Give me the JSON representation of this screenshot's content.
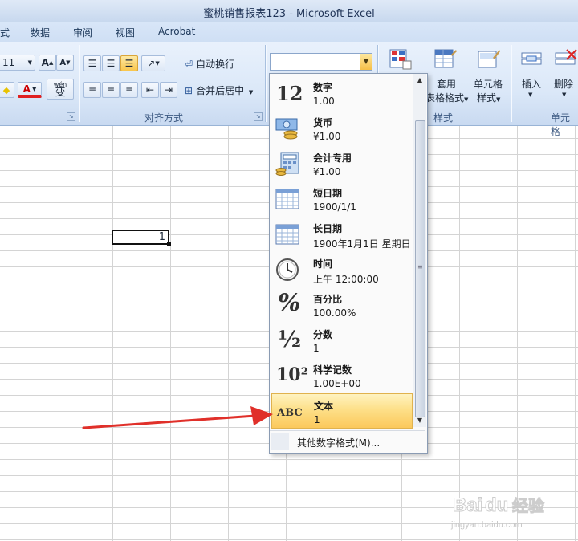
{
  "window": {
    "title": "蜜桃销售报表123 - Microsoft Excel"
  },
  "tabs": [
    "式",
    "数据",
    "审阅",
    "视图",
    "Acrobat"
  ],
  "ribbon": {
    "font_size": "11",
    "font_grow": "A",
    "font_shrink": "A",
    "font_color_letter": "A",
    "wrap_text": "自动换行",
    "merge_center": "合并后居中",
    "alignment_group": "对齐方式",
    "styles_group": "样式",
    "table_format": "表格格式",
    "cell_styles": "单元格\n样式",
    "cell_styles_line1": "单元格",
    "cell_styles_line2": "样式",
    "table_format_line1": "套用",
    "insert": "插入",
    "delete": "删除",
    "cells_group": "单元格",
    "phonetic": "wén"
  },
  "sheet": {
    "active_cell_value": "1"
  },
  "number_format": {
    "current": "",
    "items": [
      {
        "icon": "number-12-icon",
        "glyph": "12",
        "name": "数字",
        "example": "1.00"
      },
      {
        "icon": "currency-icon",
        "glyph": "",
        "name": "货币",
        "example": "¥1.00"
      },
      {
        "icon": "accounting-icon",
        "glyph": "",
        "name": "会计专用",
        "example": " ¥1.00"
      },
      {
        "icon": "short-date-calendar-icon",
        "glyph": "",
        "name": "短日期",
        "example": "1900/1/1"
      },
      {
        "icon": "long-date-calendar-icon",
        "glyph": "",
        "name": "长日期",
        "example": "1900年1月1日 星期日"
      },
      {
        "icon": "clock-icon",
        "glyph": "",
        "name": "时间",
        "example": "上午 12:00:00"
      },
      {
        "icon": "percent-icon",
        "glyph": "%",
        "name": "百分比",
        "example": "100.00%"
      },
      {
        "icon": "fraction-icon",
        "glyph": "½",
        "name": "分数",
        "example": "1"
      },
      {
        "icon": "scientific-icon",
        "glyph": "10²",
        "name": "科学记数",
        "example": "1.00E+00"
      },
      {
        "icon": "abc-text-icon",
        "glyph": "ABC",
        "name": "文本",
        "example": "1"
      }
    ],
    "more_formats": "其他数字格式(M)...",
    "selected_index": 9
  },
  "watermark": {
    "brand": "Bai",
    "paw": "du",
    "suffix": "经验",
    "url": "jingyan.baidu.com"
  },
  "colors": {
    "selection": "#fbc95c",
    "arrow": "#e0302a",
    "ribbon": "#dbe8f8"
  }
}
